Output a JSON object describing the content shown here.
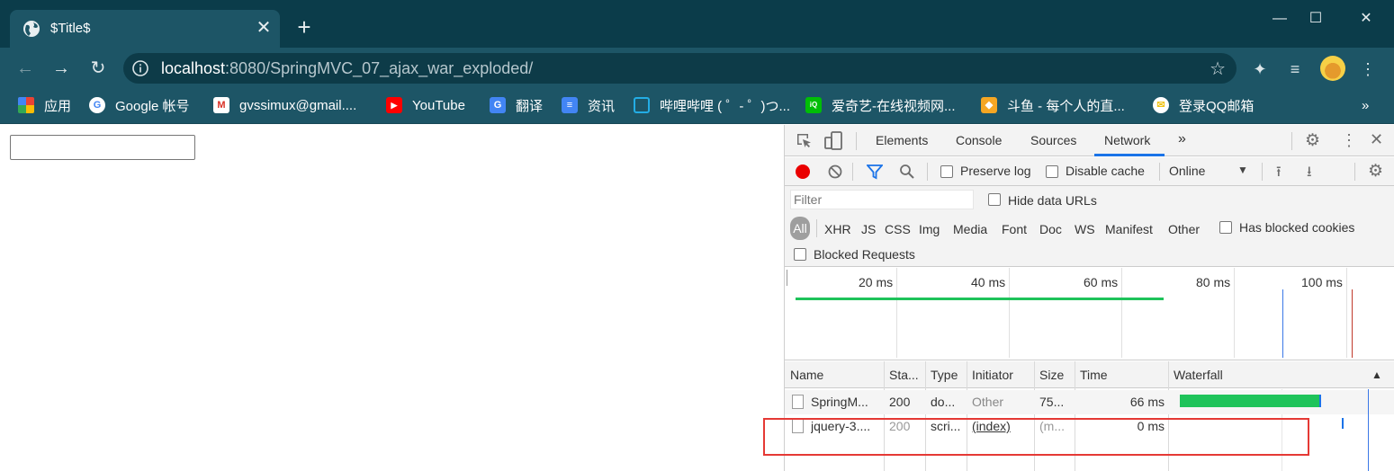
{
  "browser": {
    "tab_title": "$Title$",
    "url_host": "localhost",
    "url_rest": ":8080/SpringMVC_07_ajax_war_exploded/",
    "new_tab_symbol": "+",
    "close_symbol": "✕",
    "window_controls": [
      "—",
      "☐",
      "✕"
    ]
  },
  "bookmarks": [
    {
      "label": "应用",
      "icon": "apps-grid-icon",
      "color": "#e8453c"
    },
    {
      "label": "Google 帐号",
      "icon": "google-icon",
      "color": "#4285f4"
    },
    {
      "label": "gvssimux@gmail....",
      "icon": "gmail-icon",
      "color": "#d93025"
    },
    {
      "label": "YouTube",
      "icon": "youtube-icon",
      "color": "#ff0000"
    },
    {
      "label": "翻译",
      "icon": "translate-icon",
      "color": "#4285f4"
    },
    {
      "label": "资讯",
      "icon": "news-icon",
      "color": "#4285f4"
    },
    {
      "label": "哔哩哔哩 ( ゜- ゜)つ...",
      "icon": "bilibili-icon",
      "color": "#23ade5"
    },
    {
      "label": "爱奇艺-在线视频网...",
      "icon": "iqiyi-icon",
      "color": "#00be06"
    },
    {
      "label": "斗鱼 - 每个人的直...",
      "icon": "douyu-icon",
      "color": "#f5a623"
    },
    {
      "label": "登录QQ邮箱",
      "icon": "qqmail-icon",
      "color": "#f0c419"
    }
  ],
  "bookmarks_more": "»",
  "devtools": {
    "tabs": [
      "Elements",
      "Console",
      "Sources",
      "Network"
    ],
    "more_tabs": "»",
    "active_tab": "Network",
    "toolbar": {
      "preserve_log": "Preserve log",
      "disable_cache": "Disable cache",
      "throttle": "Online"
    },
    "filter": {
      "placeholder": "Filter",
      "hide_data_urls": "Hide data URLs",
      "all": "All",
      "types": [
        "XHR",
        "JS",
        "CSS",
        "Img",
        "Media",
        "Font",
        "Doc",
        "WS",
        "Manifest",
        "Other"
      ],
      "has_blocked_cookies": "Has blocked cookies",
      "blocked_requests": "Blocked Requests"
    },
    "overview_ticks": [
      "20 ms",
      "40 ms",
      "60 ms",
      "80 ms",
      "100 ms"
    ],
    "columns": [
      "Name",
      "Sta...",
      "Type",
      "Initiator",
      "Size",
      "Time",
      "Waterfall"
    ],
    "sort_indicator": "▲",
    "requests": [
      {
        "name": "SpringM...",
        "status": "200",
        "type": "do...",
        "initiator": "Other",
        "size": "75...",
        "time": "66 ms"
      },
      {
        "name": "jquery-3....",
        "status": "200",
        "type": "scri...",
        "initiator": "(index)",
        "size": "(m...",
        "time": "0 ms"
      }
    ],
    "colors": {
      "accent": "#1a73e8",
      "waterfall_bar": "#1ec35a",
      "record": "#ea0000",
      "highlight": "#e53935"
    }
  }
}
